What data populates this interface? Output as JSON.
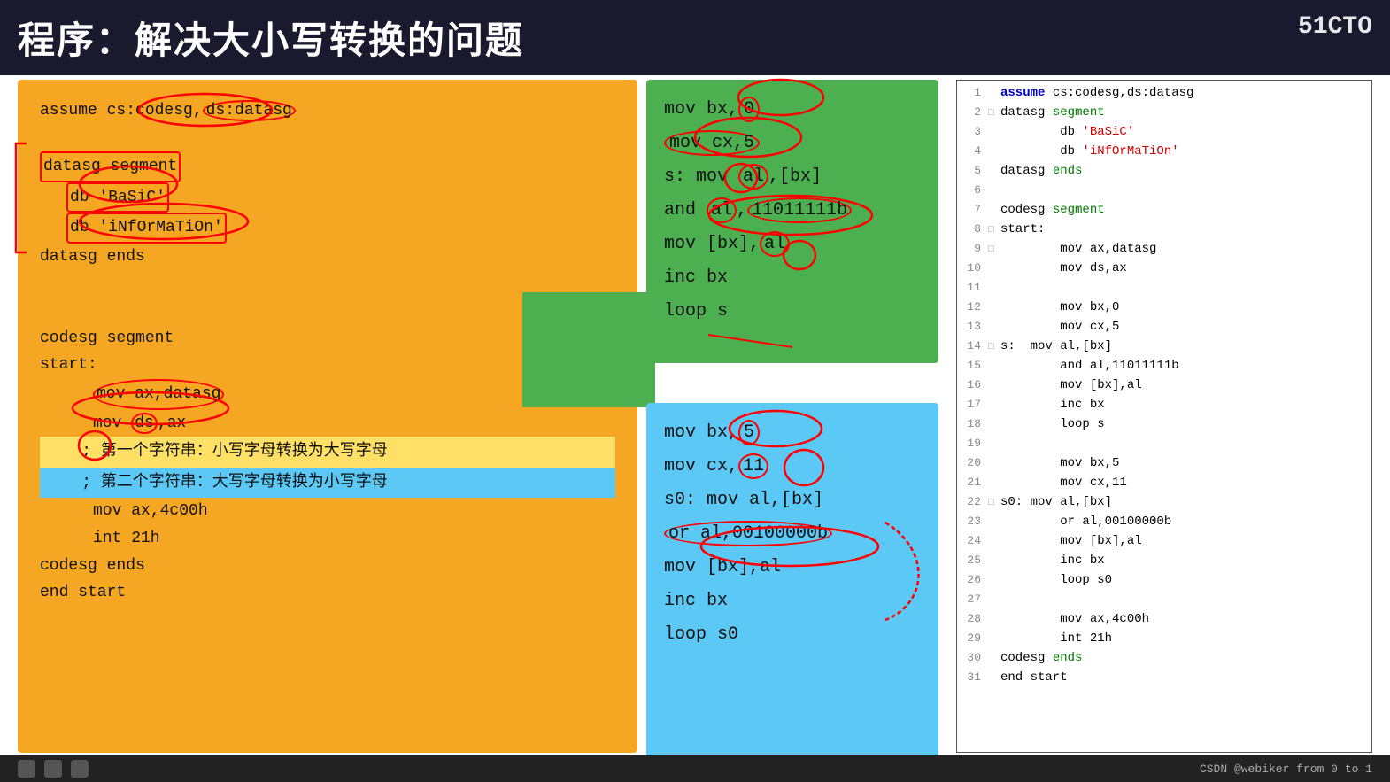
{
  "title": "程序：解决大小写转换的问题",
  "logo": "51CTO",
  "yellow_code": {
    "lines": [
      {
        "text": "assume cs:codesg,ds:datasg",
        "indent": 0
      },
      {
        "text": "",
        "indent": 0
      },
      {
        "text": "datasg segment",
        "indent": 0
      },
      {
        "text": "db 'BaSiC'",
        "indent": 1
      },
      {
        "text": "db 'iNfOrMaTiOn'",
        "indent": 1
      },
      {
        "text": "datasg ends",
        "indent": 0
      },
      {
        "text": "",
        "indent": 0
      },
      {
        "text": "",
        "indent": 0
      },
      {
        "text": "codesg segment",
        "indent": 0
      },
      {
        "text": "start:",
        "indent": 0
      },
      {
        "text": "mov ax,datasg",
        "indent": 2
      },
      {
        "text": "mov ds,ax",
        "indent": 2
      },
      {
        "text": "; 第一个字符串：小写字母转换为大写字母",
        "indent": 2,
        "highlight": "yellow"
      },
      {
        "text": "; 第二个字符串：大写字母转换为小写字母",
        "indent": 2,
        "highlight": "blue"
      },
      {
        "text": "mov ax,4c00h",
        "indent": 2
      },
      {
        "text": "int 21h",
        "indent": 2
      },
      {
        "text": "codesg ends",
        "indent": 0
      },
      {
        "text": "end start",
        "indent": 0
      }
    ]
  },
  "green_panel": {
    "lines": [
      "mov bx,0",
      "mov cx,5",
      "s: mov al,[bx]",
      "and al,11011111b",
      "mov [bx],al",
      "inc bx",
      "loop s"
    ]
  },
  "blue_panel": {
    "lines": [
      "mov bx,5",
      "mov cx,11",
      "s0: mov al,[bx]",
      "or al,00100000b",
      "mov [bx],al",
      "inc bx",
      "loop s0"
    ]
  },
  "code_editor": {
    "lines": [
      {
        "num": "1",
        "marker": "",
        "code": "assume cs:codesg,ds:datasg",
        "parts": [
          {
            "text": "assume ",
            "class": "kw-blue"
          },
          {
            "text": "cs:codesg,ds:datasg",
            "class": "kw-normal"
          }
        ]
      },
      {
        "num": "2",
        "marker": "□",
        "code": "datasg segment",
        "parts": [
          {
            "text": "datasg ",
            "class": "kw-normal"
          },
          {
            "text": "segment",
            "class": "kw-green"
          }
        ]
      },
      {
        "num": "3",
        "marker": "",
        "code": "    db 'BaSiC'",
        "parts": [
          {
            "text": "        db ",
            "class": "kw-normal"
          },
          {
            "text": "'BaSiC'",
            "class": "kw-red"
          }
        ]
      },
      {
        "num": "4",
        "marker": "",
        "code": "    db 'iNfOrMaTiOn'",
        "parts": [
          {
            "text": "        db ",
            "class": "kw-normal"
          },
          {
            "text": "'iNfOrMaTiOn'",
            "class": "kw-red"
          }
        ]
      },
      {
        "num": "5",
        "marker": "",
        "code": "datasg ends",
        "parts": [
          {
            "text": "datasg ",
            "class": "kw-normal"
          },
          {
            "text": "ends",
            "class": "kw-green"
          }
        ]
      },
      {
        "num": "6",
        "marker": "",
        "code": "",
        "parts": []
      },
      {
        "num": "7",
        "marker": "",
        "code": "codesg segment",
        "parts": [
          {
            "text": "codesg ",
            "class": "kw-normal"
          },
          {
            "text": "segment",
            "class": "kw-green"
          }
        ]
      },
      {
        "num": "8",
        "marker": "□",
        "code": "start:",
        "parts": [
          {
            "text": "start:",
            "class": "kw-normal"
          }
        ]
      },
      {
        "num": "9",
        "marker": "□",
        "code": "    mov ax,datasg",
        "parts": [
          {
            "text": "        mov ax,datasg",
            "class": "kw-normal"
          }
        ]
      },
      {
        "num": "10",
        "marker": "",
        "code": "    mov ds,ax",
        "parts": [
          {
            "text": "        mov ds,ax",
            "class": "kw-normal"
          }
        ]
      },
      {
        "num": "11",
        "marker": "",
        "code": "",
        "parts": []
      },
      {
        "num": "12",
        "marker": "",
        "code": "    mov bx,0",
        "parts": [
          {
            "text": "        mov bx,0",
            "class": "kw-normal"
          }
        ]
      },
      {
        "num": "13",
        "marker": "",
        "code": "    mov cx,5",
        "parts": [
          {
            "text": "        mov cx,5",
            "class": "kw-normal"
          }
        ]
      },
      {
        "num": "14",
        "marker": "□",
        "code": "s:  mov al,[bx]",
        "parts": [
          {
            "text": "s:  mov al,[bx]",
            "class": "kw-normal"
          }
        ]
      },
      {
        "num": "15",
        "marker": "",
        "code": "    and al,11011111b",
        "parts": [
          {
            "text": "        and al,11011111b",
            "class": "kw-normal"
          }
        ]
      },
      {
        "num": "16",
        "marker": "",
        "code": "    mov [bx],al",
        "parts": [
          {
            "text": "        mov [bx],al",
            "class": "kw-normal"
          }
        ]
      },
      {
        "num": "17",
        "marker": "",
        "code": "    inc bx",
        "parts": [
          {
            "text": "        inc bx",
            "class": "kw-normal"
          }
        ]
      },
      {
        "num": "18",
        "marker": "",
        "code": "    loop s",
        "parts": [
          {
            "text": "        loop s",
            "class": "kw-normal"
          }
        ]
      },
      {
        "num": "19",
        "marker": "",
        "code": "",
        "parts": []
      },
      {
        "num": "20",
        "marker": "",
        "code": "    mov bx,5",
        "parts": [
          {
            "text": "        mov bx,5",
            "class": "kw-normal"
          }
        ]
      },
      {
        "num": "21",
        "marker": "",
        "code": "    mov cx,11",
        "parts": [
          {
            "text": "        mov cx,11",
            "class": "kw-normal"
          }
        ]
      },
      {
        "num": "22",
        "marker": "□",
        "code": "s0: mov al,[bx]",
        "parts": [
          {
            "text": "s0: mov al,[bx]",
            "class": "kw-normal"
          }
        ]
      },
      {
        "num": "23",
        "marker": "",
        "code": "    or al,00100000b",
        "parts": [
          {
            "text": "        or al,00100000b",
            "class": "kw-normal"
          }
        ]
      },
      {
        "num": "24",
        "marker": "",
        "code": "    mov [bx],al",
        "parts": [
          {
            "text": "        mov [bx],al",
            "class": "kw-normal"
          }
        ]
      },
      {
        "num": "25",
        "marker": "",
        "code": "    inc bx",
        "parts": [
          {
            "text": "        inc bx",
            "class": "kw-normal"
          }
        ]
      },
      {
        "num": "26",
        "marker": "",
        "code": "    loop s0",
        "parts": [
          {
            "text": "        loop s0",
            "class": "kw-normal"
          }
        ]
      },
      {
        "num": "27",
        "marker": "",
        "code": "",
        "parts": []
      },
      {
        "num": "28",
        "marker": "",
        "code": "    mov ax,4c00h",
        "parts": [
          {
            "text": "        mov ax,4c00h",
            "class": "kw-normal"
          }
        ]
      },
      {
        "num": "29",
        "marker": "",
        "code": "    int 21h",
        "parts": [
          {
            "text": "        int 21h",
            "class": "kw-normal"
          }
        ]
      },
      {
        "num": "30",
        "marker": "",
        "code": "codesg ends",
        "parts": [
          {
            "text": "codesg ",
            "class": "kw-normal"
          },
          {
            "text": "ends",
            "class": "kw-green"
          }
        ]
      },
      {
        "num": "31",
        "marker": "",
        "code": "end start",
        "parts": [
          {
            "text": "end start",
            "class": "kw-normal"
          }
        ]
      }
    ]
  },
  "bottom_bar": {
    "credit": "CSDN @webiker from 0 to 1"
  }
}
